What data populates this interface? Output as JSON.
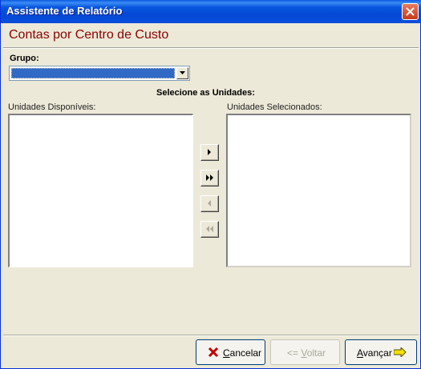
{
  "window": {
    "title": "Assistente de Relatório"
  },
  "header": {
    "title": "Contas por Centro de Custo"
  },
  "grupo": {
    "label": "Grupo:",
    "selected": ""
  },
  "unidades": {
    "heading": "Selecione as Unidades:",
    "available_label": "Unidades Disponíveis:",
    "selected_label": "Unidades Selecionados:",
    "available_items": [],
    "selected_items": []
  },
  "buttons": {
    "cancel": {
      "mnemonic": "C",
      "rest": "ancelar"
    },
    "back": {
      "prefix": "<=",
      "mnemonic": "V",
      "rest": "oltar",
      "enabled": false
    },
    "next": {
      "mnemonic": "A",
      "rest": "vançar",
      "suffix": "=>"
    }
  },
  "colors": {
    "header_title": "#8b0000",
    "titlebar": "#0a4ddc",
    "window_bg": "#ece9d8"
  }
}
